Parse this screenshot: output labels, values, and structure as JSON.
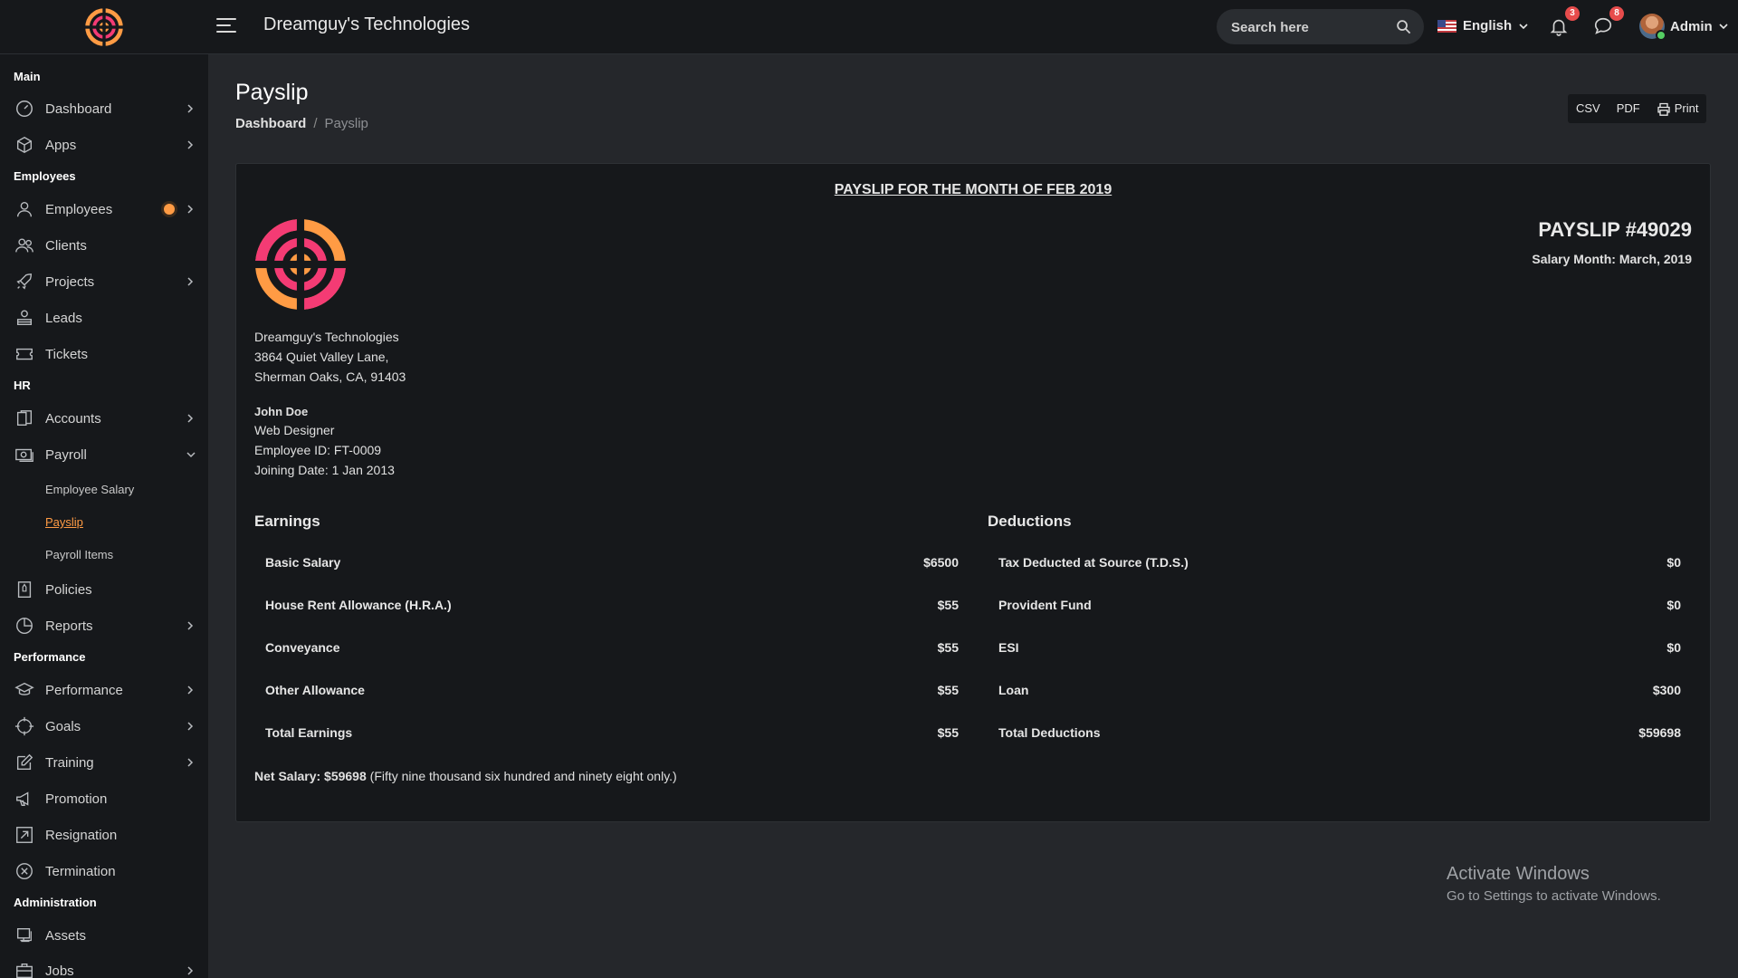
{
  "header": {
    "app_title": "Dreamguy's Technologies",
    "search_placeholder": "Search here",
    "language": "English",
    "notifications_count": "3",
    "messages_count": "8",
    "user_name": "Admin"
  },
  "sidebar": {
    "sections": {
      "main": "Main",
      "employees": "Employees",
      "hr": "HR",
      "performance": "Performance",
      "administration": "Administration"
    },
    "items": {
      "dashboard": "Dashboard",
      "apps": "Apps",
      "employees": "Employees",
      "clients": "Clients",
      "projects": "Projects",
      "leads": "Leads",
      "tickets": "Tickets",
      "accounts": "Accounts",
      "payroll": "Payroll",
      "policies": "Policies",
      "reports": "Reports",
      "performance": "Performance",
      "goals": "Goals",
      "training": "Training",
      "promotion": "Promotion",
      "resignation": "Resignation",
      "termination": "Termination",
      "assets": "Assets",
      "jobs": "Jobs"
    },
    "payroll_sub": {
      "employee_salary": "Employee Salary",
      "payslip": "Payslip",
      "payroll_items": "Payroll Items"
    }
  },
  "page": {
    "title": "Payslip",
    "breadcrumb_home": "Dashboard",
    "breadcrumb_sep": "/",
    "breadcrumb_current": "Payslip",
    "actions": {
      "csv": "CSV",
      "pdf": "PDF",
      "print": "Print"
    }
  },
  "payslip": {
    "heading": "PAYSLIP FOR THE MONTH OF FEB 2019",
    "number": "PAYSLIP #49029",
    "salary_month_label": "Salary Month:",
    "salary_month_value": "March, 2019",
    "company": {
      "name": "Dreamguy's Technologies",
      "address1": "3864 Quiet Valley Lane,",
      "address2": "Sherman Oaks, CA, 91403"
    },
    "employee": {
      "name": "John Doe",
      "role": "Web Designer",
      "id_line": "Employee ID: FT-0009",
      "joining_line": "Joining Date: 1 Jan 2013"
    },
    "earnings_title": "Earnings",
    "earnings": [
      {
        "label": "Basic Salary",
        "value": "$6500"
      },
      {
        "label": "House Rent Allowance (H.R.A.)",
        "value": "$55"
      },
      {
        "label": "Conveyance",
        "value": "$55"
      },
      {
        "label": "Other Allowance",
        "value": "$55"
      },
      {
        "label": "Total Earnings",
        "value": "$55"
      }
    ],
    "deductions_title": "Deductions",
    "deductions": [
      {
        "label": "Tax Deducted at Source (T.D.S.)",
        "value": "$0"
      },
      {
        "label": "Provident Fund",
        "value": "$0"
      },
      {
        "label": "ESI",
        "value": "$0"
      },
      {
        "label": "Loan",
        "value": "$300"
      },
      {
        "label": "Total Deductions",
        "value": "$59698"
      }
    ],
    "net_label": "Net Salary: $59698",
    "net_words": "(Fifty nine thousand six hundred and ninety eight only.)"
  },
  "watermark": {
    "line1": "Activate Windows",
    "line2": "Go to Settings to activate Windows."
  },
  "colors": {
    "accent": "#ff9b44",
    "logo_pink": "#f43b74",
    "logo_orange": "#ff9b44",
    "sidebar_bg": "#16181b",
    "page_bg": "#25272b"
  }
}
